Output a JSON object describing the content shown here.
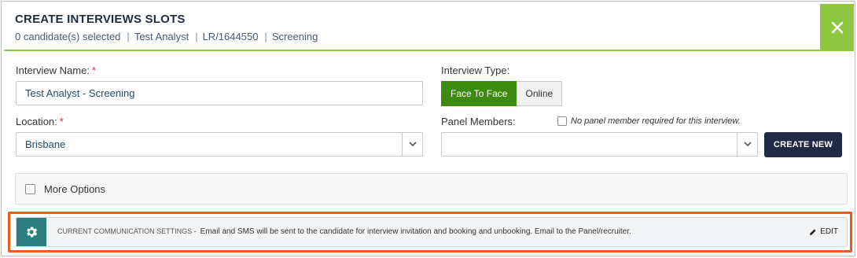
{
  "dialog": {
    "title": "CREATE INTERVIEWS SLOTS",
    "subinfo": {
      "selected": "0 candidate(s) selected",
      "job_title": "Test Analyst",
      "job_ref": "LR/1644550",
      "stage": "Screening",
      "separator": "|"
    },
    "close_icon": "close-icon"
  },
  "form": {
    "interview_name": {
      "label": "Interview Name:",
      "required_mark": "*",
      "value": "Test Analyst  - Screening"
    },
    "interview_type": {
      "label": "Interview Type:",
      "options": [
        "Face To Face",
        "Online"
      ],
      "selected": "Face To Face"
    },
    "location": {
      "label": "Location:",
      "required_mark": "*",
      "value": "Brisbane"
    },
    "panel_members": {
      "label": "Panel Members:",
      "value": "",
      "no_panel_label": "No panel member required for this interview.",
      "no_panel_checked": false
    },
    "create_new_label": "CREATE NEW",
    "more_options": {
      "label": "More Options",
      "checked": false
    }
  },
  "communication": {
    "key": "CURRENT COMMUNICATION SETTINGS -",
    "text": "Email and SMS will be sent to the candidate for interview invitation and booking and unbooking. Email to the Panel/recruiter.",
    "edit_label": "EDIT",
    "icon": "gear-icon",
    "edit_icon": "pencil-icon"
  },
  "colors": {
    "accent_green": "#8dc63f",
    "active_toggle": "#3c8a0e",
    "create_button": "#1f2a44",
    "settings_icon_bg": "#2b7f7f",
    "highlight_outline": "#e85d1a"
  }
}
